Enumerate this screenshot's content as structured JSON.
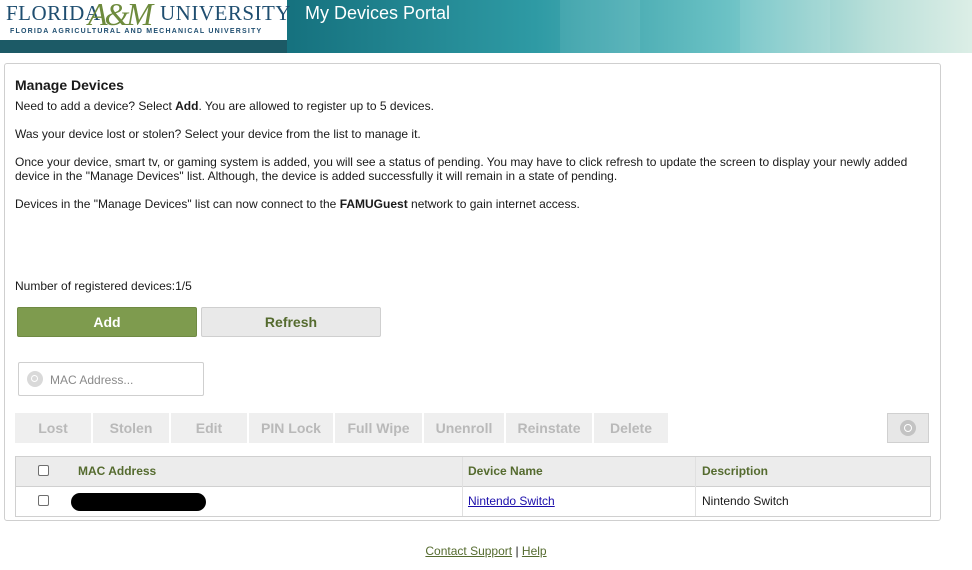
{
  "header": {
    "logo": {
      "word1": "FLORIDA",
      "am": "A&M",
      "word2": "UNIVERSITY",
      "sub": "FLORIDA AGRICULTURAL AND MECHANICAL UNIVERSITY"
    },
    "title": "My Devices Portal"
  },
  "panel": {
    "title": "Manage Devices",
    "p1": {
      "a": "Need to add a device? Select ",
      "b": "Add",
      "c": ". You are allowed to register up to 5 devices."
    },
    "p2": "Was your device lost or stolen? Select your device from the list to manage it.",
    "p3": "Once your device, smart tv, or gaming system  is added, you will see a status of pending.  You may have to click refresh to update the screen to display your newly added device in the \"Manage Devices\" list.  Although, the device is added successfully it will remain in a state of pending.",
    "p4": {
      "a": "Devices in the \"Manage Devices\" list can now connect to the ",
      "b": "FAMUGuest",
      "c": " network to gain internet access."
    },
    "count_label": "Number of registered devices:1/5",
    "add_label": "Add",
    "refresh_label": "Refresh",
    "search_placeholder": "MAC Address...",
    "actions": [
      "Lost",
      "Stolen",
      "Edit",
      "PIN Lock",
      "Full Wipe",
      "Unenroll",
      "Reinstate",
      "Delete"
    ]
  },
  "table": {
    "headers": {
      "mac": "MAC Address",
      "name": "Device Name",
      "desc": "Description"
    },
    "rows": [
      {
        "mac": "",
        "name": "Nintendo Switch",
        "desc": "Nintendo Switch"
      }
    ]
  },
  "footer": {
    "contact": "Contact Support",
    "sep": " | ",
    "help": "Help"
  },
  "colors": {
    "accent": "#7e9b4e",
    "accent_text": "#556b2f",
    "header_teal": "#16727f"
  }
}
